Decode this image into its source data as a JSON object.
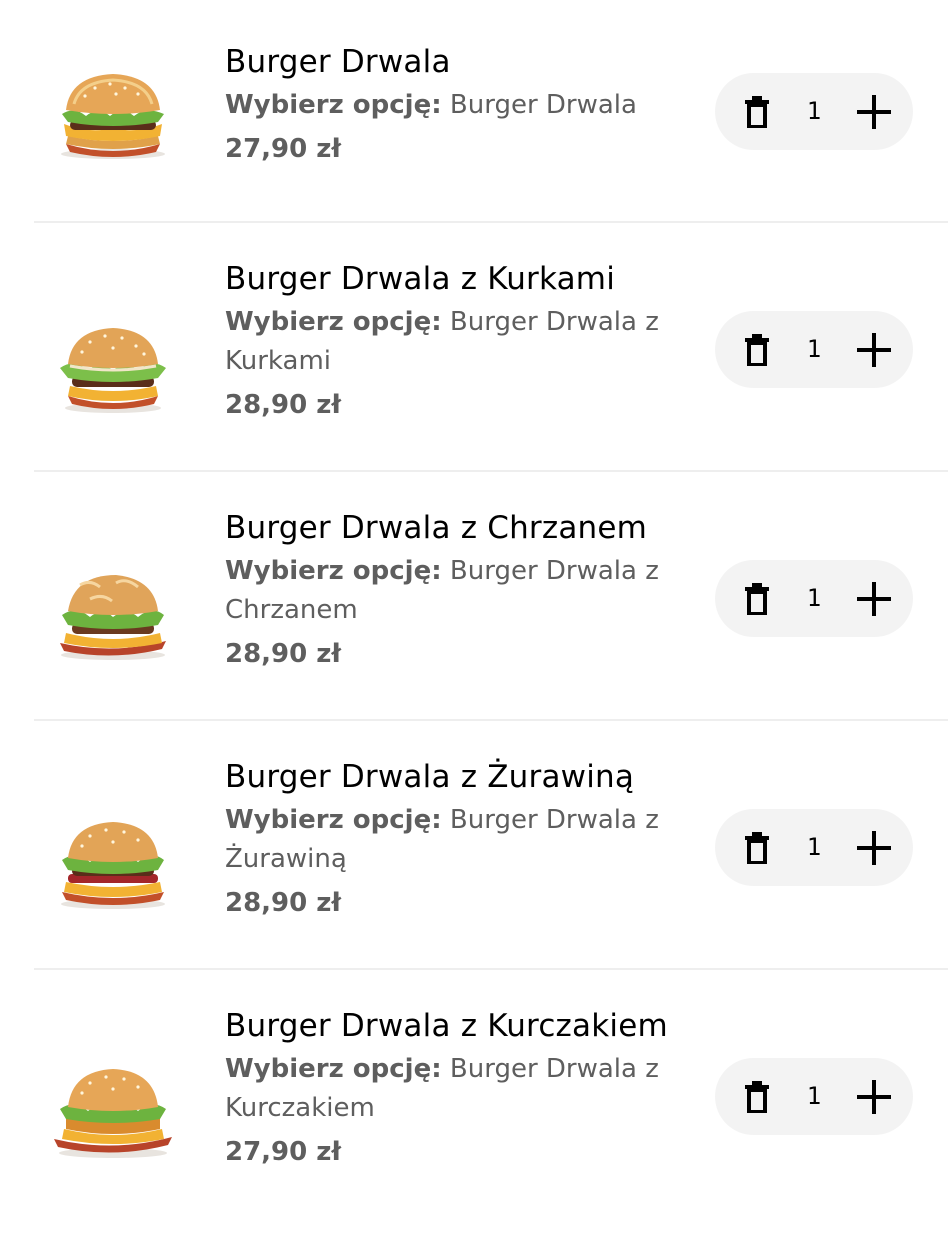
{
  "cart": {
    "items": [
      {
        "name": "Burger Drwala",
        "option_label": "Wybierz opcję:",
        "option_value": " Burger Drwala",
        "price": "27,90 zł",
        "quantity": "1",
        "image": "burger-image",
        "icons": {
          "delete": "trash-icon",
          "add": "plus-icon"
        }
      },
      {
        "name": "Burger Drwala z Kurkami",
        "option_label": "Wybierz opcję:",
        "option_value": " Burger Drwala z Kurkami",
        "price": "28,90 zł",
        "quantity": "1",
        "image": "burger-image",
        "icons": {
          "delete": "trash-icon",
          "add": "plus-icon"
        }
      },
      {
        "name": "Burger Drwala z Chrzanem",
        "option_label": "Wybierz opcję:",
        "option_value": " Burger Drwala z Chrzanem",
        "price": "28,90 zł",
        "quantity": "1",
        "image": "burger-image",
        "icons": {
          "delete": "trash-icon",
          "add": "plus-icon"
        }
      },
      {
        "name": "Burger Drwala z Żurawiną",
        "option_label": "Wybierz opcję:",
        "option_value": " Burger Drwala z Żurawiną",
        "price": "28,90 zł",
        "quantity": "1",
        "image": "burger-image",
        "icons": {
          "delete": "trash-icon",
          "add": "plus-icon"
        }
      },
      {
        "name": "Burger Drwala z Kurczakiem",
        "option_label": "Wybierz opcję:",
        "option_value": " Burger Drwala z Kurczakiem",
        "price": "27,90 zł",
        "quantity": "1",
        "image": "burger-image",
        "icons": {
          "delete": "trash-icon",
          "add": "plus-icon"
        }
      }
    ]
  },
  "colors": {
    "text_primary": "#000000",
    "text_secondary": "#5e5e5e",
    "stepper_bg": "#f3f3f3",
    "divider": "#eeeeee"
  }
}
